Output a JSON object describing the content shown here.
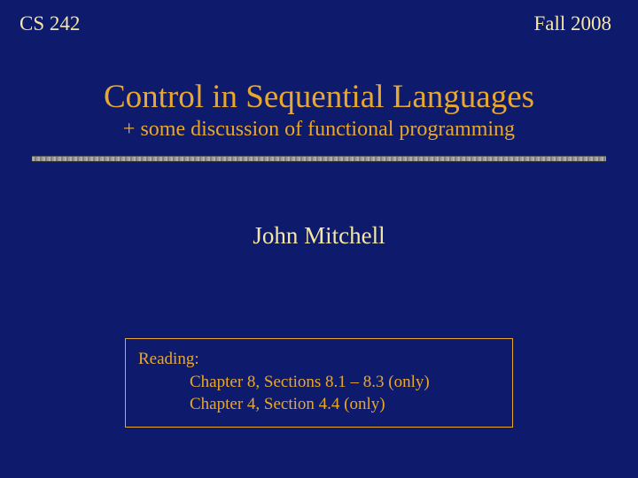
{
  "header": {
    "course": "CS 242",
    "term": "Fall 2008"
  },
  "title": {
    "main": "Control in Sequential Languages",
    "sub": "+ some discussion of functional programming"
  },
  "author": "John Mitchell",
  "reading": {
    "label": "Reading:",
    "line1": "Chapter 8, Sections 8.1 – 8.3 (only)",
    "line2": "Chapter 4, Section 4.4 (only)"
  }
}
